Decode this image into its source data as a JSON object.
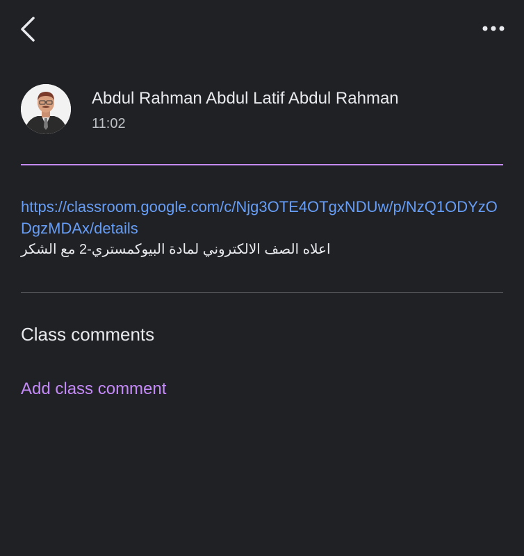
{
  "header": {
    "back_icon": "chevron-left-icon",
    "more_icon": "more-horizontal-icon"
  },
  "post": {
    "author": "Abdul Rahman Abdul Latif Abdul Rahman",
    "time": "11:02",
    "link": "https://classroom.google.com/c/Njg3OTE4OTgxNDUw/p/NzQ1ODYzODgzMDAx/details",
    "text": "اعلاه الصف الالكتروني  لمادة البيوكمستري-2 مع الشكر"
  },
  "comments": {
    "heading": "Class comments",
    "add_label": "Add class comment"
  },
  "colors": {
    "background": "#202124",
    "accent": "#c58af9",
    "link": "#669df6"
  }
}
